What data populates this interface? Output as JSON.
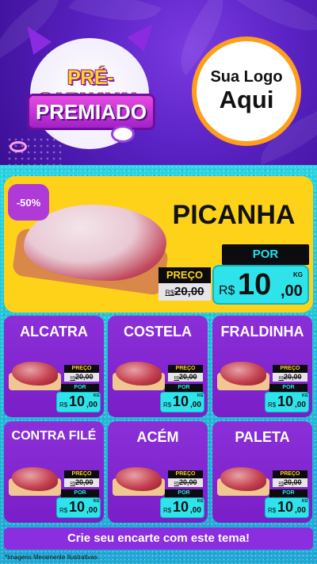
{
  "campaign": {
    "title_line1": "PRÉ-CARNAVAL",
    "title_line2": "PREMIADO"
  },
  "logo": {
    "line1": "Sua Logo",
    "line2": "Aqui"
  },
  "featured": {
    "discount_badge": "-50%",
    "name": "PICANHA",
    "old_price_label": "PREÇO",
    "old_price_currency": "R$",
    "old_price_value": "20,00",
    "new_price_label": "POR",
    "new_price_currency": "R$",
    "new_price_int": "10",
    "new_price_dec": ",00",
    "unit": "KG"
  },
  "products": [
    {
      "name": "ALCATRA",
      "old_label": "PREÇO",
      "old_currency": "R$",
      "old_value": "20,00",
      "new_label": "POR",
      "currency": "R$",
      "int": "10",
      "dec": ",00",
      "unit": "KG"
    },
    {
      "name": "COSTELA",
      "old_label": "PREÇO",
      "old_currency": "R$",
      "old_value": "20,00",
      "new_label": "POR",
      "currency": "R$",
      "int": "10",
      "dec": ",00",
      "unit": "KG"
    },
    {
      "name": "FRALDINHA",
      "old_label": "PREÇO",
      "old_currency": "R$",
      "old_value": "20,00",
      "new_label": "POR",
      "currency": "R$",
      "int": "10",
      "dec": ",00",
      "unit": "KG"
    },
    {
      "name": "CONTRA FILÉ",
      "old_label": "PREÇO",
      "old_currency": "R$",
      "old_value": "20,00",
      "new_label": "POR",
      "currency": "R$",
      "int": "10",
      "dec": ",00",
      "unit": "KG"
    },
    {
      "name": "ACÉM",
      "old_label": "PREÇO",
      "old_currency": "R$",
      "old_value": "20,00",
      "new_label": "POR",
      "currency": "R$",
      "int": "10",
      "dec": ",00",
      "unit": "KG"
    },
    {
      "name": "PALETA",
      "old_label": "PREÇO",
      "old_currency": "R$",
      "old_value": "20,00",
      "new_label": "POR",
      "currency": "R$",
      "int": "10",
      "dec": ",00",
      "unit": "KG"
    }
  ],
  "footer": {
    "cta": "Crie seu encarte com este tema!",
    "disclaimer": "*Imagens Meramente Ilustrativas"
  },
  "colors": {
    "header_purple": "#5a22c4",
    "card_purple": "#7a1fc8",
    "featured_yellow": "#ffd21a",
    "price_cyan": "#2fe3ea",
    "logo_ring_orange": "#ff9e1b"
  },
  "icons": [
    "trumpet-icon",
    "drum-icon"
  ]
}
